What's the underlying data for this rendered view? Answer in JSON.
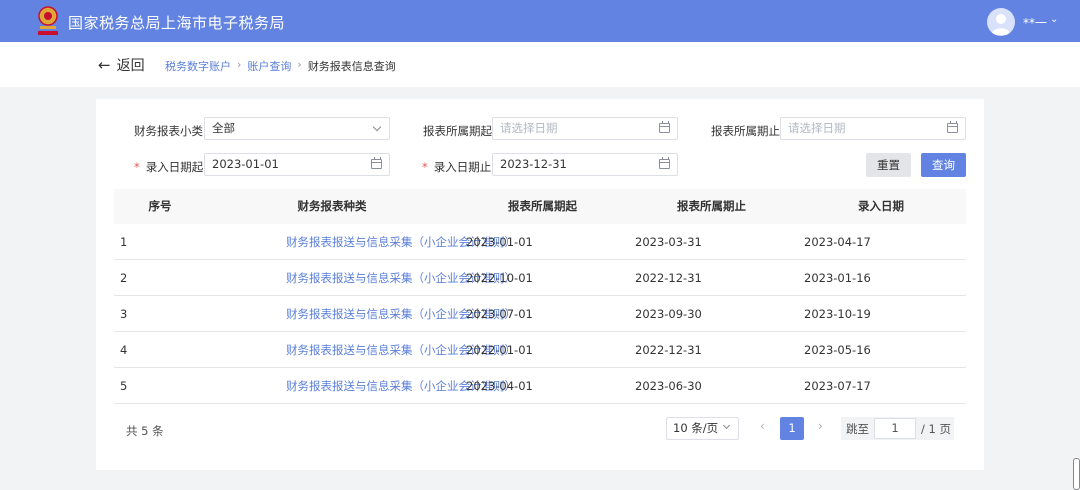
{
  "header": {
    "title": "国家税务总局上海市电子税务局",
    "user_name": "**一",
    "caret": "⌄",
    "brand_color": "#6283e2"
  },
  "nav": {
    "back_label": "返回",
    "breadcrumb": [
      "税务数字账户",
      "账户查询",
      "财务报表信息查询"
    ],
    "separator": "›"
  },
  "filters": {
    "category": {
      "label": "财务报表小类",
      "value": "全部"
    },
    "period_start": {
      "label": "报表所属期起",
      "placeholder": "请选择日期"
    },
    "period_end": {
      "label": "报表所属期止",
      "placeholder": "请选择日期"
    },
    "entry_start": {
      "label": "录入日期起",
      "value": "2023-01-01",
      "required_mark": "*"
    },
    "entry_end": {
      "label": "录入日期止",
      "value": "2023-12-31",
      "required_mark": "*"
    },
    "reset_label": "重置",
    "query_label": "查询"
  },
  "table": {
    "columns": [
      "序号",
      "财务报表种类",
      "报表所属期起",
      "报表所属期止",
      "录入日期"
    ],
    "rows": [
      [
        "1",
        "财务报表报送与信息采集（小企业会计准则）",
        "2023-01-01",
        "2023-03-31",
        "2023-04-17"
      ],
      [
        "2",
        "财务报表报送与信息采集（小企业会计准则）",
        "2022-10-01",
        "2022-12-31",
        "2023-01-16"
      ],
      [
        "3",
        "财务报表报送与信息采集（小企业会计准则）",
        "2023-07-01",
        "2023-09-30",
        "2023-10-19"
      ],
      [
        "4",
        "财务报表报送与信息采集（小企业会计准则）",
        "2022-01-01",
        "2022-12-31",
        "2023-05-16"
      ],
      [
        "5",
        "财务报表报送与信息采集（小企业会计准则）",
        "2023-04-01",
        "2023-06-30",
        "2023-07-17"
      ]
    ]
  },
  "pagination": {
    "total": "共 5 条",
    "page_size": "10 条/页",
    "current_page": "1",
    "prev": "‹",
    "next": "›",
    "jump_label": "跳至",
    "jump_value": "1",
    "total_pages": "/ 1 页"
  }
}
